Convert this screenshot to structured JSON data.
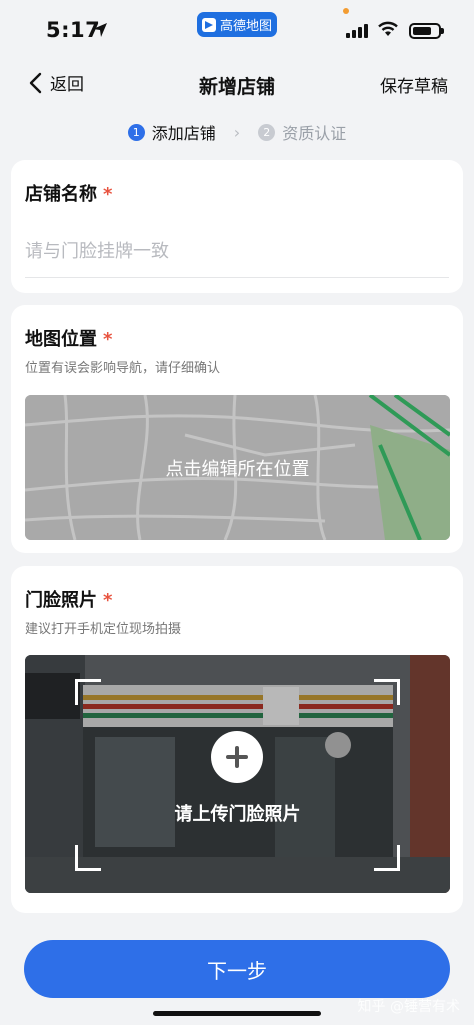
{
  "status_bar": {
    "time": "5:17",
    "app_pill": "高德地图"
  },
  "nav": {
    "back_label": "返回",
    "title": "新增店铺",
    "save_draft": "保存草稿"
  },
  "steps": [
    {
      "num": "1",
      "label": "添加店铺",
      "state": "active"
    },
    {
      "num": "2",
      "label": "资质认证",
      "state": "inactive"
    }
  ],
  "store_name": {
    "title": "店铺名称",
    "required_mark": "*",
    "placeholder": "请与门脸挂牌一致",
    "value": ""
  },
  "map_location": {
    "title": "地图位置",
    "required_mark": "*",
    "subtitle": "位置有误会影响导航，请仔细确认",
    "map_label": "点击编辑所在位置"
  },
  "storefront_photo": {
    "title": "门脸照片",
    "required_mark": "*",
    "subtitle": "建议打开手机定位现场拍摄",
    "upload_label": "请上传门脸照片"
  },
  "next_button": "下一步",
  "watermark": "知乎 @锤营有术",
  "colors": {
    "primary": "#2e6fe8",
    "required": "#e8533f",
    "background": "#f2f3f5"
  }
}
